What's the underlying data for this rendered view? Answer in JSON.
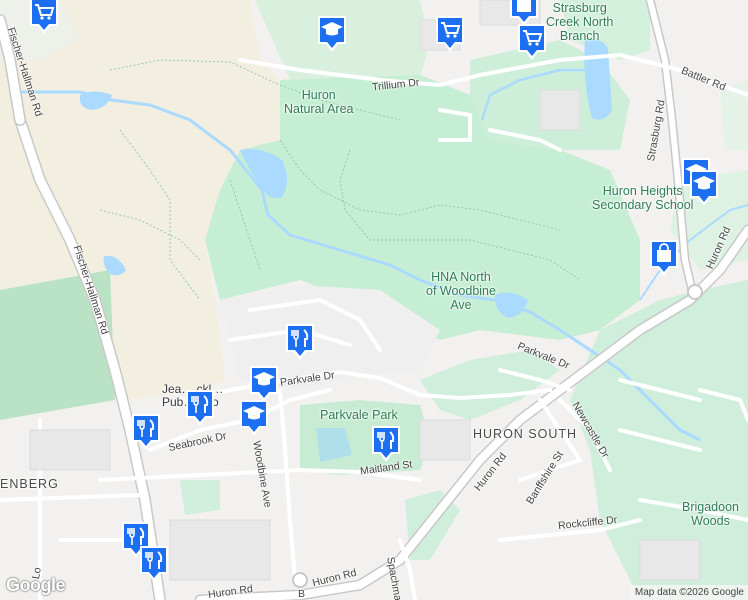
{
  "map": {
    "labels": {
      "strasburg_creek": "Strasburg\nCreek North\nBranch",
      "huron_natural_area": "Huron\nNatural Area",
      "hna_north": "HNA North\nof Woodbine\nAve",
      "huron_heights": "Huron Heights\nSecondary School",
      "parkvale_park": "Parkvale Park",
      "huron_south": "HURON SOUTH",
      "brigadoon_woods": "Brigadoon\nWoods",
      "enberg": "ENBERG",
      "jean_school": "Jea… ckl…\nPub… hoo",
      "fischer_hallman_1": "Fischer-Hallman Rd",
      "fischer_hallman_2": "Fischer-Hallman Rd",
      "trillium": "Trillium Dr",
      "battler": "Battler Rd",
      "strasburg_rd": "Strasburg Rd",
      "huron_rd_1": "Huron Rd",
      "huron_rd_2": "Huron Rd",
      "huron_rd_3": "Huron Rd",
      "huron_rd_4": "Huron Rd",
      "parkvale_dr_1": "Parkvale Dr",
      "parkvale_dr_2": "Parkvale Dr",
      "seabrook": "Seabrook Dr",
      "woodbine": "Woodbine Ave",
      "maitland": "Maitland St",
      "newcastle": "Newcastle Dr",
      "banffshire": "Banffshire St",
      "rockcliffe": "Rockcliffe Dr",
      "spachman": "Spachman",
      "left_edge": "Lo",
      "b_road": "B"
    },
    "pins": [
      {
        "id": "grocery-1",
        "icon": "shopping-cart-icon"
      },
      {
        "id": "grocery-2",
        "icon": "shopping-cart-icon"
      },
      {
        "id": "grocery-3",
        "icon": "shopping-cart-icon"
      },
      {
        "id": "store-1",
        "icon": "shopping-bag-icon"
      },
      {
        "id": "store-2",
        "icon": "shopping-bag-icon"
      },
      {
        "id": "school-1",
        "icon": "graduation-cap-icon"
      },
      {
        "id": "school-2",
        "icon": "graduation-cap-icon"
      },
      {
        "id": "school-3",
        "icon": "graduation-cap-icon"
      },
      {
        "id": "school-4",
        "icon": "graduation-cap-icon"
      },
      {
        "id": "school-5",
        "icon": "graduation-cap-icon"
      },
      {
        "id": "restaurant-1",
        "icon": "fork-knife-icon"
      },
      {
        "id": "restaurant-2",
        "icon": "fork-knife-icon"
      },
      {
        "id": "restaurant-3",
        "icon": "fork-knife-icon"
      },
      {
        "id": "restaurant-4",
        "icon": "fork-knife-icon"
      },
      {
        "id": "restaurant-5",
        "icon": "fork-knife-icon"
      },
      {
        "id": "restaurant-6",
        "icon": "fork-knife-icon"
      }
    ],
    "google_logo": "Google",
    "attribution": "Map data ©2026 Google"
  }
}
